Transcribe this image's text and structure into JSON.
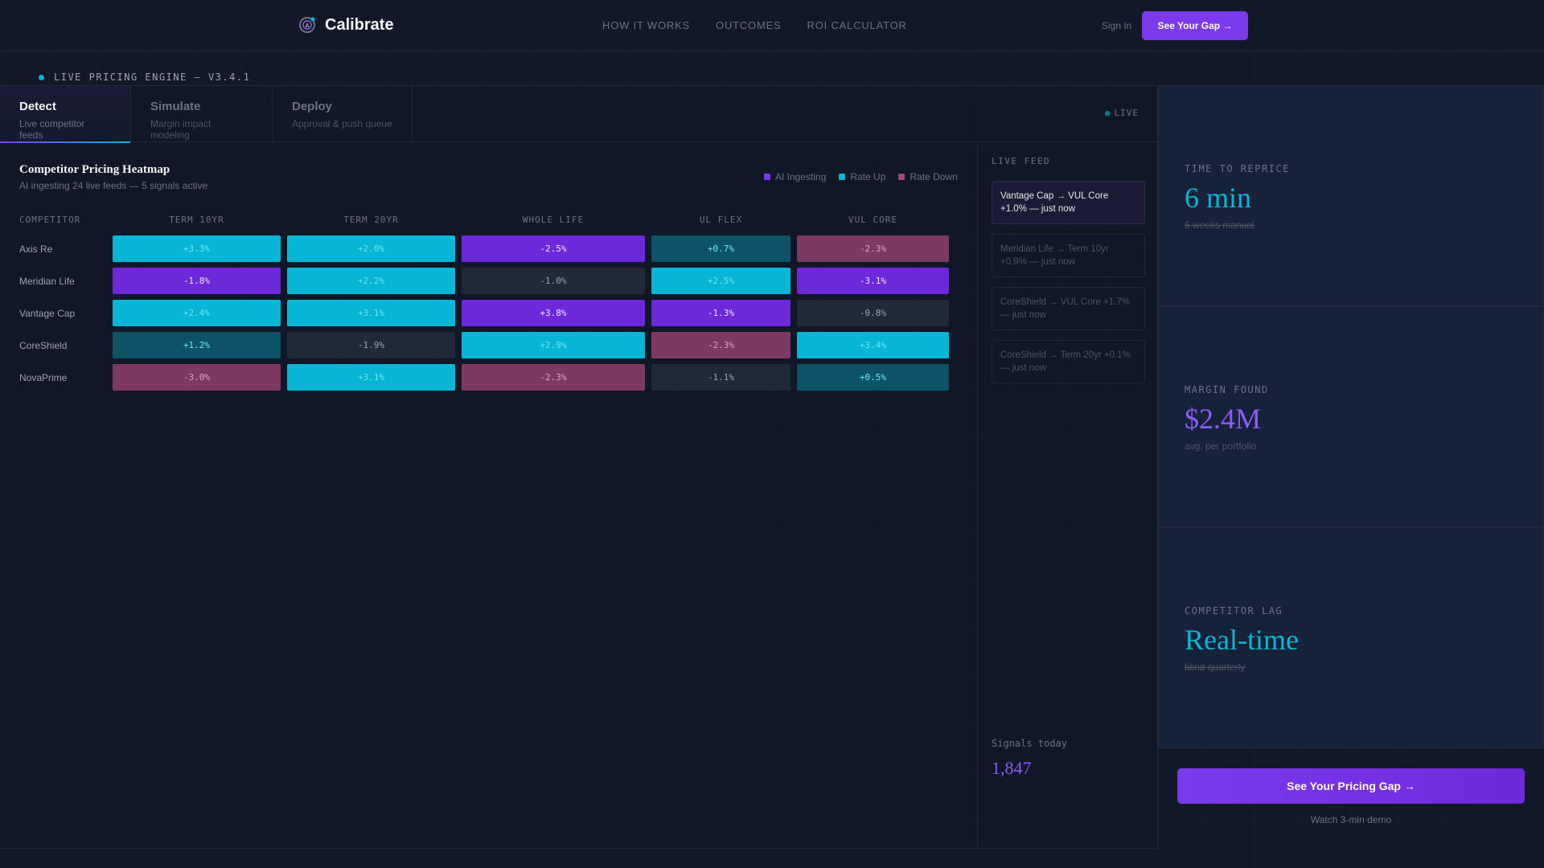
{
  "brand": {
    "name": "Calibrate",
    "logo_icon": "ai-ring-logo-icon"
  },
  "nav": {
    "links": [
      "HOW IT WORKS",
      "OUTCOMES",
      "ROI CALCULATOR"
    ],
    "signin": "Sign In",
    "cta": "See Your Gap →"
  },
  "engine_label": "LIVE PRICING ENGINE — V3.4.1",
  "tabs": [
    {
      "title": "Detect",
      "sub": "Live competitor feeds",
      "active": true
    },
    {
      "title": "Simulate",
      "sub": "Margin impact modeling",
      "active": false
    },
    {
      "title": "Deploy",
      "sub": "Approval & push queue",
      "active": false
    }
  ],
  "live_tag": "LIVE",
  "heatmap": {
    "title": "Competitor Pricing Heatmap",
    "subtitle": "AI ingesting 24 live feeds — 5 signals active",
    "legend": [
      {
        "label": "AI Ingesting",
        "color": "#7c3aed"
      },
      {
        "label": "Rate Up",
        "color": "#06b6d4"
      },
      {
        "label": "Rate Down",
        "color": "#9d4b7c"
      }
    ],
    "columns": [
      "COMPETITOR",
      "TERM 10YR",
      "TERM 20YR",
      "WHOLE LIFE",
      "UL FLEX",
      "VUL CORE"
    ],
    "rows": [
      {
        "name": "Axis Re",
        "cells": [
          {
            "value": "+3.3%",
            "state": "cyan"
          },
          {
            "value": "+2.0%",
            "state": "cyan"
          },
          {
            "value": "-2.5%",
            "state": "purple"
          },
          {
            "value": "+0.7%",
            "state": "teal"
          },
          {
            "value": "-2.3%",
            "state": "rose"
          }
        ]
      },
      {
        "name": "Meridian Life",
        "cells": [
          {
            "value": "-1.8%",
            "state": "purple"
          },
          {
            "value": "+2.2%",
            "state": "cyan"
          },
          {
            "value": "-1.0%",
            "state": "dark"
          },
          {
            "value": "+2.5%",
            "state": "cyan"
          },
          {
            "value": "-3.1%",
            "state": "purple"
          }
        ]
      },
      {
        "name": "Vantage Cap",
        "cells": [
          {
            "value": "+2.4%",
            "state": "cyan"
          },
          {
            "value": "+3.1%",
            "state": "cyan"
          },
          {
            "value": "+3.8%",
            "state": "purple"
          },
          {
            "value": "-1.3%",
            "state": "purple"
          },
          {
            "value": "-0.8%",
            "state": "dark"
          }
        ]
      },
      {
        "name": "CoreShield",
        "cells": [
          {
            "value": "+1.2%",
            "state": "teal"
          },
          {
            "value": "-1.9%",
            "state": "dark"
          },
          {
            "value": "+2.9%",
            "state": "cyan"
          },
          {
            "value": "-2.3%",
            "state": "rose"
          },
          {
            "value": "+3.4%",
            "state": "cyan"
          }
        ]
      },
      {
        "name": "NovaPrime",
        "cells": [
          {
            "value": "-3.0%",
            "state": "rose"
          },
          {
            "value": "+3.1%",
            "state": "cyan"
          },
          {
            "value": "-2.3%",
            "state": "rose"
          },
          {
            "value": "-1.1%",
            "state": "dark"
          },
          {
            "value": "+0.5%",
            "state": "teal"
          }
        ]
      }
    ]
  },
  "feed": {
    "label": "LIVE FEED",
    "items": [
      {
        "text": "Vantage Cap → VUL Core +1.0% — just now",
        "active": true
      },
      {
        "text": "Meridian Life → Term 10yr +0.9% — just now",
        "active": false
      },
      {
        "text": "CoreShield → VUL Core +1.7% — just now",
        "active": false
      },
      {
        "text": "CoreShield → Term 20yr +0.1% — just now",
        "active": false
      }
    ],
    "signals_label": "Signals today",
    "signals_value": "1,847"
  },
  "stats": [
    {
      "label": "TIME TO REPRICE",
      "value": "6 min",
      "note": "6 weeks manual",
      "value_color": "#06b6d4",
      "strike": true
    },
    {
      "label": "MARGIN FOUND",
      "value": "$2.4M",
      "note": "avg. per portfolio",
      "value_color": "#8b5cf6",
      "strike": false
    },
    {
      "label": "COMPETITOR LAG",
      "value": "Real-time",
      "note": "blind quarterly",
      "value_color": "#06b6d4",
      "strike": true
    }
  ],
  "cta_big": "See Your Pricing Gap →",
  "demo_link": "Watch 3-min demo"
}
